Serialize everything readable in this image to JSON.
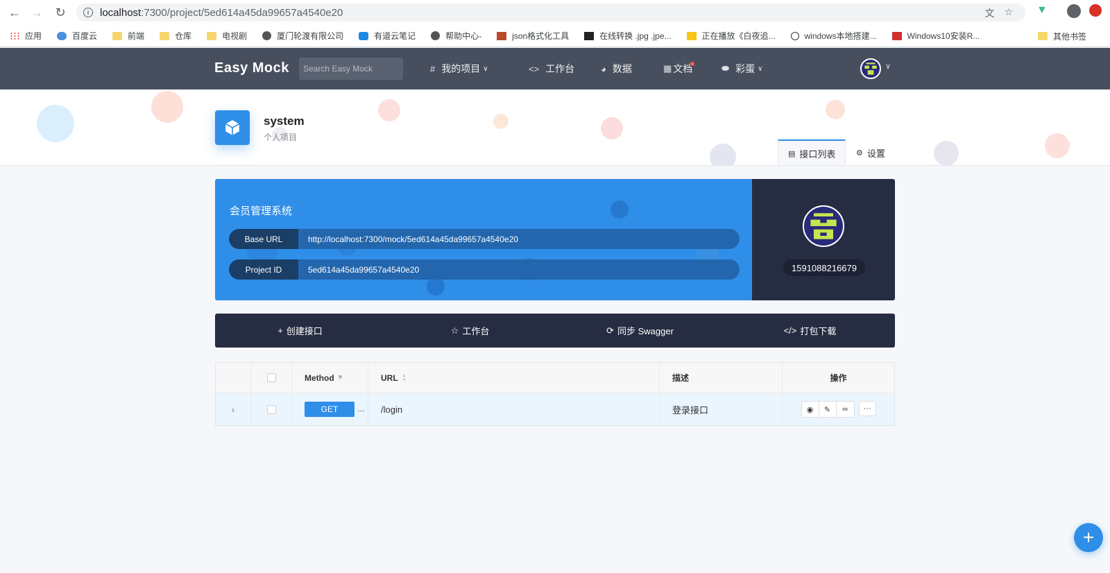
{
  "browser": {
    "url_host": "localhost",
    "url_path": ":7300/project/5ed614a45da99657a4540e20",
    "bookmarks": [
      {
        "label": "应用",
        "type": "apps"
      },
      {
        "label": "百度云",
        "type": "site"
      },
      {
        "label": "前端",
        "type": "folder"
      },
      {
        "label": "仓库",
        "type": "folder"
      },
      {
        "label": "电视剧",
        "type": "folder"
      },
      {
        "label": "厦门轮渡有限公司",
        "type": "globe"
      },
      {
        "label": "有道云笔记",
        "type": "site"
      },
      {
        "label": "帮助中心-",
        "type": "globe"
      },
      {
        "label": "json格式化工具",
        "type": "site"
      },
      {
        "label": "在线转换 .jpg .jpe...",
        "type": "site"
      },
      {
        "label": "正在播放《白夜追...",
        "type": "site"
      },
      {
        "label": "windows本地搭建...",
        "type": "site"
      },
      {
        "label": "Windows10安装R...",
        "type": "site"
      }
    ],
    "other_bookmarks": "其他书签"
  },
  "header": {
    "brand": "Easy Mock",
    "search_placeholder": "Search Easy Mock",
    "nav": {
      "projects": "我的项目",
      "workbench": "工作台",
      "data": "数据",
      "docs": "文档",
      "easter_egg": "彩蛋"
    }
  },
  "project": {
    "name": "system",
    "type": "个人项目",
    "tabs": {
      "api_list": "接口列表",
      "settings": "设置"
    },
    "info": {
      "title": "会员管理系统",
      "base_url_label": "Base URL",
      "base_url": "http://localhost:7300/mock/5ed614a45da99657a4540e20",
      "project_id_label": "Project ID",
      "project_id": "5ed614a45da99657a4540e20"
    },
    "owner": "1591088216679"
  },
  "actions": {
    "create": "创建接口",
    "workbench": "工作台",
    "sync_swagger": "同步 Swagger",
    "download": "打包下载"
  },
  "table": {
    "headers": {
      "method": "Method",
      "url": "URL",
      "desc": "描述",
      "ops": "操作"
    },
    "rows": [
      {
        "method": "GET",
        "url": "/login",
        "desc": "登录接口"
      }
    ]
  },
  "colors": {
    "primary": "#2f8ee8",
    "header_bg": "#474f5f",
    "dark_card": "#262c42"
  }
}
